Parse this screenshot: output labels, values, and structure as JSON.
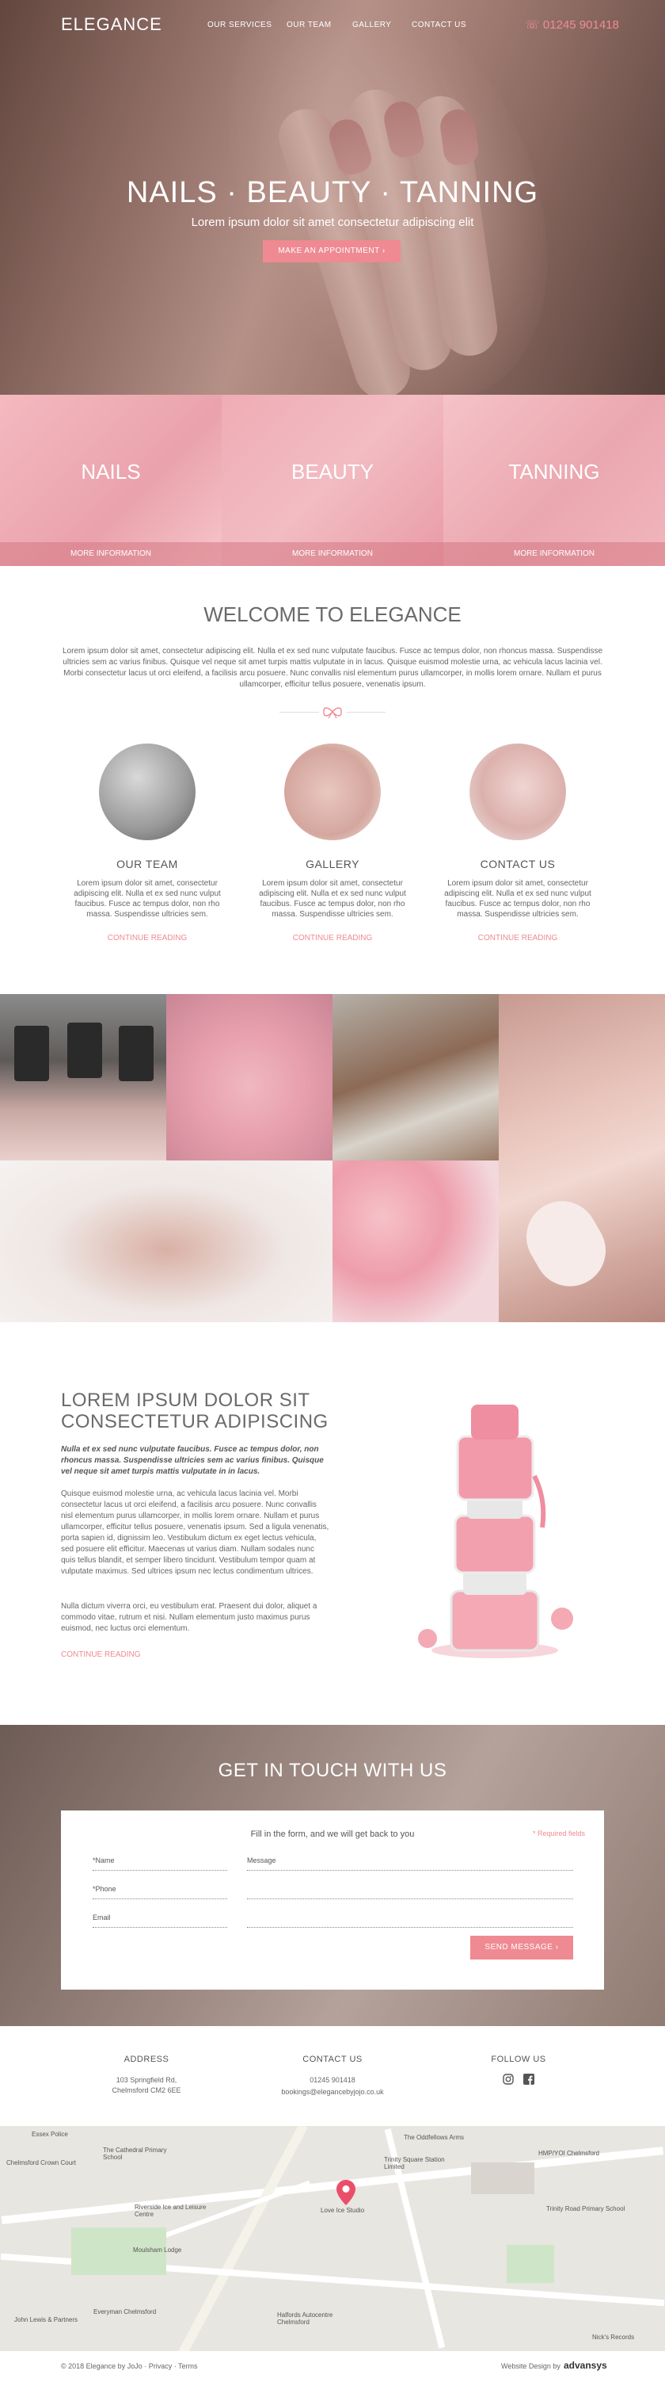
{
  "nav": {
    "logo": "ELEGANCE",
    "items": [
      "OUR SERVICES",
      "OUR TEAM",
      "GALLERY",
      "CONTACT US"
    ],
    "phone": "☏ 01245 901418"
  },
  "hero": {
    "title": "NAILS · BEAUTY · TANNING",
    "subtitle": "Lorem ipsum dolor sit amet consectetur adipiscing elit",
    "button": "MAKE AN APPOINTMENT  ›"
  },
  "services": [
    {
      "label": "NAILS",
      "more": "MORE INFORMATION"
    },
    {
      "label": "BEAUTY",
      "more": "MORE INFORMATION"
    },
    {
      "label": "TANNING",
      "more": "MORE INFORMATION"
    }
  ],
  "welcome": {
    "title": "WELCOME TO ELEGANCE",
    "text": "Lorem ipsum dolor sit amet, consectetur adipiscing elit. Nulla et ex sed nunc vulputate faucibus. Fusce ac tempus dolor, non rhoncus massa. Suspendisse ultricies sem ac varius finibus. Quisque vel neque sit amet turpis mattis vulputate in in lacus. Quisque euismod molestie urna, ac vehicula lacus lacinia vel. Morbi consectetur lacus ut orci eleifend, a facilisis arcu posuere. Nunc convallis nisl elementum purus ullamcorper, in mollis lorem ornare. Nullam et purus ullamcorper, efficitur tellus posuere, venenatis ipsum."
  },
  "features": [
    {
      "title": "OUR TEAM",
      "text": "Lorem ipsum dolor sit amet, consectetur adipiscing elit. Nulla et ex sed nunc vulput faucibus. Fusce ac tempus dolor, non rho massa. Suspendisse ultricies sem.",
      "link": "CONTINUE READING"
    },
    {
      "title": "GALLERY",
      "text": "Lorem ipsum dolor sit amet, consectetur adipiscing elit. Nulla et ex sed nunc vulput faucibus. Fusce ac tempus dolor, non rho massa. Suspendisse ultricies sem.",
      "link": "CONTINUE READING"
    },
    {
      "title": "CONTACT US",
      "text": "Lorem ipsum dolor sit amet, consectetur adipiscing elit. Nulla et ex sed nunc vulput faucibus. Fusce ac tempus dolor, non rho massa. Suspendisse ultricies sem.",
      "link": "CONTINUE READING"
    }
  ],
  "lorem": {
    "title": "LOREM IPSUM DOLOR SIT CONSECTETUR ADIPISCING",
    "bold": "Nulla et ex sed nunc vulputate faucibus. Fusce ac tempus dolor, non rhoncus massa. Suspendisse ultricies sem ac varius finibus. Quisque vel neque sit amet turpis mattis vulputate in in lacus.",
    "p1": "Quisque euismod molestie urna, ac vehicula lacus lacinia vel. Morbi consectetur lacus ut orci eleifend, a facilisis arcu posuere. Nunc convallis nisl elementum purus ullamcorper, in mollis lorem ornare. Nullam et purus ullamcorper, efficitur tellus posuere, venenatis ipsum. Sed a ligula venenatis, porta sapien id, dignissim leo. Vestibulum dictum ex eget lectus vehicula, sed posuere elit efficitur. Maecenas ut varius diam. Nullam sodales nunc quis tellus blandit, et semper libero tincidunt. Vestibulum tempor quam at vulputate maximus. Sed ultrices ipsum nec lectus condimentum ultrices.",
    "p2": "Nulla dictum viverra orci, eu vestibulum erat. Praesent dui dolor, aliquet a commodo vitae, rutrum et nisi. Nullam elementum justo maximus purus euismod, nec luctus orci elementum.",
    "link": "CONTINUE READING"
  },
  "contact": {
    "title": "GET IN TOUCH WITH US",
    "intro": "Fill in the form, and we will get back to you",
    "required": "* Required fields",
    "name": "*Name",
    "phone": "*Phone",
    "email": "Email",
    "message": "Message",
    "button": "SEND MESSAGE  ›"
  },
  "footer": {
    "address_h": "ADDRESS",
    "address": "103 Springfield Rd, Chelmsford CM2 6EE",
    "contact_h": "CONTACT US",
    "contact_phone": "01245 901418",
    "contact_email": "bookings@elegancebyjojo.co.uk",
    "follow_h": "FOLLOW US"
  },
  "map_labels": [
    "Essex Police",
    "The Cathedral Primary School",
    "Chelmsford Crown Court",
    "Riverside Ice and Leisure Centre",
    "Moulsham Lodge",
    "John Lewis & Partners",
    "Everyman Chelmsford",
    "Love Ice Studio",
    "Trinity Road Primary School",
    "HMP/YOI Chelmsford",
    "Nick's Records",
    "Halfords Autocentre Chelmsford",
    "Trinity Square Station Limited",
    "The Oddfellows Arms"
  ],
  "bottom": {
    "left": "© 2018 Elegance by JoJo  ·  Privacy  ·  Terms",
    "right": "Website Design by",
    "brand": "advansys"
  }
}
